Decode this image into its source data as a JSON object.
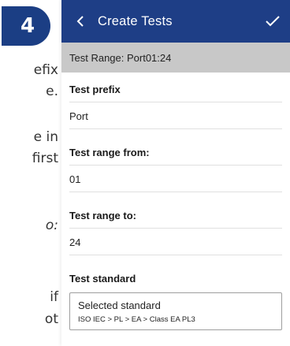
{
  "doc": {
    "step_number": "4",
    "lines": [
      "efix",
      "e.",
      "e in",
      "first",
      "o:",
      "if",
      "ot"
    ]
  },
  "app_bar": {
    "title": "Create Tests"
  },
  "banner": {
    "text": "Test Range: Port01:24"
  },
  "form": {
    "prefix_label": "Test prefix",
    "prefix_value": "Port",
    "range_from_label": "Test range from:",
    "range_from_value": "01",
    "range_to_label": "Test range to:",
    "range_to_value": "24",
    "standard_label": "Test standard",
    "standard_box_title": "Selected standard",
    "standard_path": "ISO IEC > PL > EA > Class EA PL3"
  },
  "icons": {
    "back": "chevron-left-icon",
    "confirm": "check-icon"
  },
  "colors": {
    "app_bar": "#1e3e86",
    "step_badge": "#1b3e84",
    "banner": "#c8c8c8"
  }
}
